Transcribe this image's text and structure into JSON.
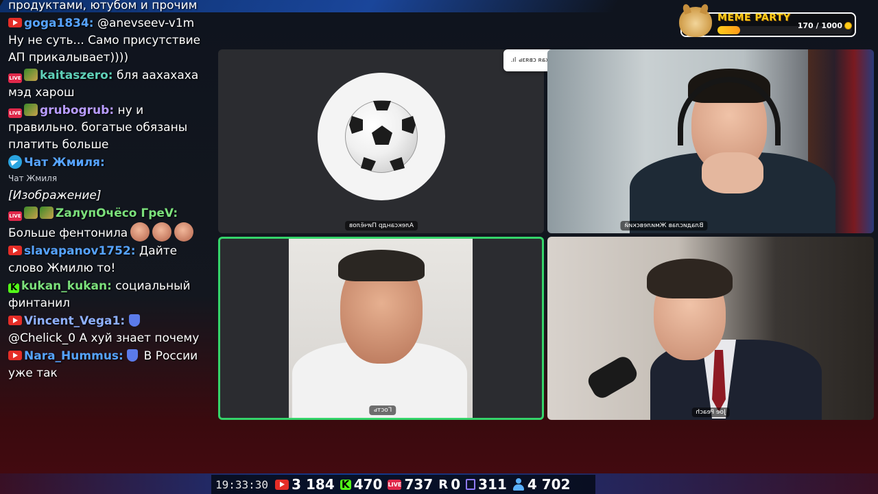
{
  "chat": {
    "messages": [
      {
        "user": "",
        "text": "продуктами, ютубом и прочим",
        "prefix": "продуктами, ютубом и",
        "suffix": "прочим",
        "badges": []
      },
      {
        "user": "goga1834:",
        "text": "@anevseev-v1m Ну не суть... Само присутствие АП прикалывает))))",
        "color": "#56a3ff",
        "badges": [
          "yt"
        ]
      },
      {
        "user": "kaitaszero:",
        "text": "бля аахахаха мэд харош",
        "color": "#5fd0b8",
        "badges": [
          "live",
          "emote"
        ]
      },
      {
        "user": "grubogrub:",
        "text": "ну и правильно. богатые обязаны платить больше",
        "color": "#b89cff",
        "badges": [
          "live",
          "emote"
        ]
      },
      {
        "user": "Чат Жмиля:",
        "text": "",
        "color": "#56a3ff",
        "badges": [
          "tg"
        ],
        "sub": "Чат Жмиля",
        "extra": "[Изображение]"
      },
      {
        "user": "ZалупОчёсо ГреV:",
        "text": "Больше фентонила",
        "color": "#7be07b",
        "badges": [
          "live",
          "emote",
          "emote"
        ]
      },
      {
        "user": "slavapanov1752:",
        "text": "Дайте слово Жмилю то!",
        "color": "#56a3ff",
        "badges": [
          "yt"
        ]
      },
      {
        "user": "kukan_kukan:",
        "text": "социальный финтанил",
        "color": "#7be07b",
        "badges": [
          "kick"
        ]
      },
      {
        "user": "Vincent_Vega1:",
        "text": "@Chelick_0 А хуй знает почему",
        "color": "#8fb0ff",
        "badges": [
          "yt",
          "shield"
        ]
      },
      {
        "user": "Nara_Hummus:",
        "text": "В России уже так",
        "color": "#56a3ff",
        "badges": [
          "yt",
          "shield"
        ]
      }
    ]
  },
  "call": {
    "toast": "У вас плохая связь",
    "tiles": [
      {
        "name": "Александр Пичёлов",
        "mirrored": true
      },
      {
        "name": "Владислав Жмилевский",
        "mirrored": true
      },
      {
        "name": "Гость",
        "mirrored": true
      },
      {
        "name": "Joe Peach",
        "mirrored": true
      }
    ]
  },
  "meme_party": {
    "title": "MEME PARTY",
    "count": "170 / 1000",
    "progress_fraction": 0.17
  },
  "stats": {
    "time": "19:33:30",
    "youtube": "3 184",
    "kick": "470",
    "live": "737",
    "r": "0",
    "twitch": "311",
    "viewers": "4 702"
  },
  "colors": {
    "accent_green": "#35d46a",
    "youtube_red": "#e52d27",
    "kick_green": "#53fc18",
    "meme_gold": "#ffcc1a"
  }
}
